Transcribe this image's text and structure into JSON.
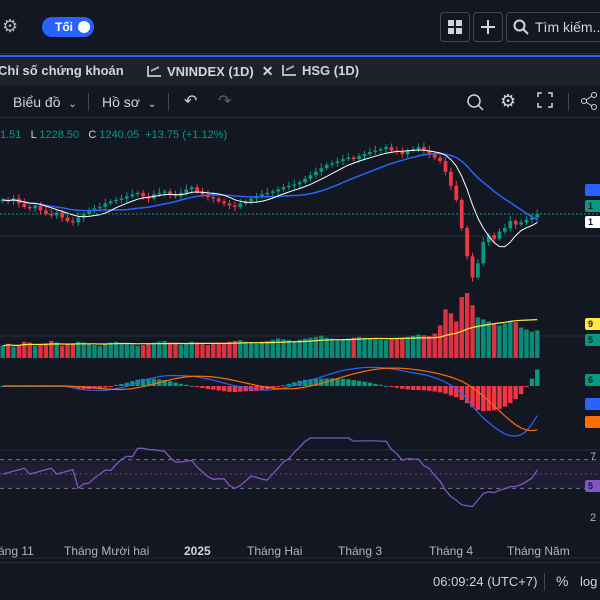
{
  "topbar": {
    "theme_toggle_label": "Tối",
    "search_label": "Tìm kiếm..."
  },
  "tabs": [
    {
      "label": "Chỉ số chứng khoán"
    },
    {
      "label": "VNINDEX (1D)"
    },
    {
      "label": "HSG (1D)"
    }
  ],
  "toolbar": {
    "chart_type_label": "Biểu đồ",
    "profile_label": "Hồ sơ"
  },
  "ohlc": {
    "partial_high": "1.51",
    "low_label": "L",
    "low": "1228.50",
    "close_label": "C",
    "close": "1240.05",
    "change": "+13.75 (+1.12%)"
  },
  "price_axis_tags": [
    {
      "text": "",
      "color": "#2962ff"
    },
    {
      "text": "1",
      "color": "#089981"
    },
    {
      "text": "1",
      "color": "#ffffff"
    },
    {
      "text": "9",
      "color": "#ffeb3b"
    },
    {
      "text": "5",
      "color": "#089981"
    },
    {
      "text": "6",
      "color": "#089981"
    },
    {
      "text": "",
      "color": "#2962ff"
    },
    {
      "text": "",
      "color": "#ff6d00"
    },
    {
      "text": "5",
      "color": "#7e57c2"
    }
  ],
  "rsi_axis": [
    "7",
    "2"
  ],
  "x_axis": [
    "áng 11",
    "Tháng Mười hai",
    "2025",
    "Tháng Hai",
    "Tháng 3",
    "Tháng 4",
    "Tháng Năm"
  ],
  "status": {
    "time": "06:09:24 (UTC+7)",
    "percent_label": "%",
    "log_label": "log"
  },
  "colors": {
    "up": "#089981",
    "down": "#f23645",
    "ma_fast": "#ffffff",
    "ma_slow": "#2962ff",
    "volume_ma": "#ffeb3b",
    "macd": "#2962ff",
    "signal": "#ff6d00",
    "rsi": "#7e57c2",
    "accent": "#2962ff"
  },
  "chart_data": {
    "type": "candlestick",
    "title": "VNINDEX (1D)",
    "last": {
      "low": 1228.5,
      "close": 1240.05,
      "change": 13.75,
      "change_pct": 1.12
    },
    "closes": [
      1260,
      1258,
      1262,
      1255,
      1250,
      1248,
      1252,
      1245,
      1240,
      1238,
      1242,
      1235,
      1230,
      1228,
      1235,
      1240,
      1245,
      1248,
      1250,
      1255,
      1258,
      1260,
      1262,
      1265,
      1268,
      1270,
      1265,
      1262,
      1268,
      1270,
      1272,
      1268,
      1265,
      1270,
      1275,
      1278,
      1272,
      1268,
      1264,
      1262,
      1258,
      1255,
      1252,
      1250,
      1255,
      1258,
      1262,
      1265,
      1268,
      1270,
      1272,
      1275,
      1278,
      1280,
      1282,
      1285,
      1290,
      1295,
      1300,
      1305,
      1310,
      1312,
      1315,
      1318,
      1320,
      1318,
      1322,
      1325,
      1328,
      1330,
      1332,
      1335,
      1330,
      1328,
      1325,
      1330,
      1332,
      1335,
      1330,
      1325,
      1320,
      1315,
      1300,
      1280,
      1260,
      1220,
      1180,
      1150,
      1170,
      1200,
      1210,
      1205,
      1215,
      1220,
      1230,
      1225,
      1228,
      1232,
      1235,
      1240
    ],
    "volumes": [
      30,
      35,
      28,
      32,
      40,
      38,
      30,
      34,
      36,
      42,
      38,
      30,
      33,
      35,
      40,
      38,
      36,
      32,
      30,
      34,
      38,
      40,
      36,
      35,
      33,
      30,
      32,
      36,
      38,
      40,
      42,
      38,
      35,
      33,
      36,
      40,
      38,
      34,
      32,
      35,
      36,
      38,
      40,
      42,
      44,
      40,
      38,
      36,
      40,
      42,
      45,
      48,
      46,
      44,
      42,
      45,
      48,
      50,
      52,
      55,
      50,
      48,
      46,
      45,
      48,
      50,
      52,
      50,
      48,
      46,
      45,
      44,
      46,
      48,
      50,
      52,
      55,
      58,
      56,
      54,
      60,
      80,
      120,
      110,
      90,
      150,
      160,
      130,
      100,
      95,
      90,
      85,
      80,
      85,
      90,
      88,
      75,
      70,
      65,
      68
    ],
    "rsi_bands": [
      70,
      30
    ]
  }
}
